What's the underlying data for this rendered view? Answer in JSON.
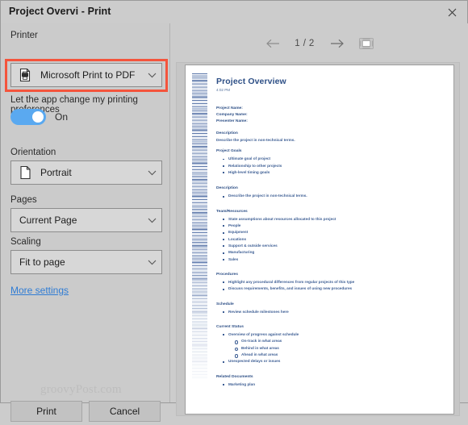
{
  "window": {
    "title": "Project Overvi - Print",
    "close_icon": "close-icon"
  },
  "settings": {
    "printer": {
      "label": "Printer",
      "value": "Microsoft Print to PDF",
      "icon": "printer-icon",
      "chevron": "chevron-down-icon",
      "highlight_color": "#f4543c"
    },
    "app_preference": {
      "label": "Let the app change my printing preferences",
      "toggle_state": "On",
      "toggle_color": "#5aa9f0"
    },
    "orientation": {
      "label": "Orientation",
      "value": "Portrait",
      "icon": "page-portrait-icon",
      "chevron": "chevron-down-icon"
    },
    "pages": {
      "label": "Pages",
      "value": "Current Page",
      "chevron": "chevron-down-icon"
    },
    "scaling": {
      "label": "Scaling",
      "value": "Fit to page",
      "chevron": "chevron-down-icon"
    },
    "more_settings_link": "More settings"
  },
  "watermark": "groovyPost.com",
  "actions": {
    "print_label": "Print",
    "cancel_label": "Cancel"
  },
  "preview": {
    "prev_icon": "arrow-left-icon",
    "next_icon": "arrow-right-icon",
    "page_indicator": "1 / 2",
    "fit_icon": "fit-to-window-icon",
    "document": {
      "title": "Project Overview",
      "time": "4:02 PM",
      "fields": [
        "Project Name:",
        "Company Name:",
        "Presenter Name:"
      ],
      "sections": [
        {
          "heading": "Description",
          "paragraph": "Describe the project in non-technical terms.",
          "bullets": []
        },
        {
          "heading": "Project Goals",
          "paragraph": "",
          "bullets": [
            "Ultimate goal of project",
            "Relationship to other projects",
            "High-level timing goals"
          ]
        },
        {
          "heading": "Description",
          "paragraph": "",
          "bullets": [
            "Describe the project in non-technical terms."
          ]
        },
        {
          "heading": "Team/Resources",
          "paragraph": "",
          "bullets": [
            "State assumptions about resources allocated to this project",
            "People",
            "Equipment",
            "Locations",
            "Support & outside services",
            "Manufacturing",
            "Sales"
          ]
        },
        {
          "heading": "Procedures",
          "paragraph": "",
          "bullets": [
            "Highlight any procedural differences from regular projects of this type",
            "Discuss requirements, benefits, and issues of using new procedures"
          ]
        },
        {
          "heading": "Schedule",
          "paragraph": "",
          "bullets": [
            "Review schedule milestones here"
          ]
        },
        {
          "heading": "Current Status",
          "paragraph": "",
          "bullets": [
            "Overview of progress against schedule"
          ],
          "subbullets": [
            "On-track in what areas",
            "Behind in what areas",
            "Ahead in what areas"
          ],
          "bullets_after": [
            "Unexpected delays or issues"
          ]
        },
        {
          "heading": "Related Documents",
          "paragraph": "",
          "bullets": [
            "Marketing plan"
          ]
        }
      ]
    }
  }
}
